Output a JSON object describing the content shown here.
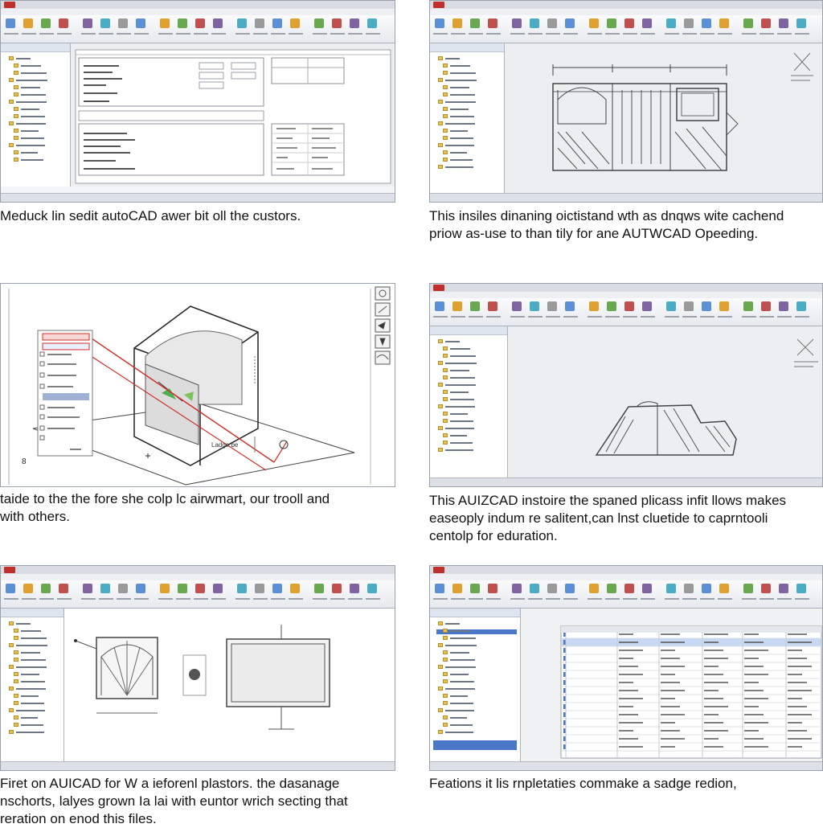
{
  "captions": {
    "p1": "Meduck lin sedit autoCAD awer bit oll the custors.",
    "p2": "This insiles dinaning oictistand wth as dnqws wite cachend\npriow as-use to than tily for ane AUTWCAD Opeeding.",
    "p3": "taide to the the fore she colp lc airwmart, our trooll and\nwith others.",
    "p4": "This AUIZCAD instoire the spaned plicass infit llows makes\neaseoply indum re salitent,can lnst cluetide to caprntooli\ncentolp for eduration.",
    "p5": "Firet on AUICAD for W a ieforenl plastors. the dasanage\nnschorts, lalyes grown Ia lai with euntor wrich secting that\nreration on enod this files.",
    "p6": "Feations it lis rnpletaties commake a sadge redion,"
  },
  "panel3_dims": {
    "label": "Ladge be",
    "marker": "8"
  },
  "colors": {
    "ribbon_red": "#c0302a",
    "selection_blue": "#4a78c8",
    "folder_yellow": "#e8c04a",
    "construction_red": "#d0302a",
    "accent_green": "#4caf50"
  },
  "icons": [
    "folder-icon",
    "app-menu-icon",
    "pen-icon",
    "pointer-icon",
    "arrow-tool-icon"
  ]
}
